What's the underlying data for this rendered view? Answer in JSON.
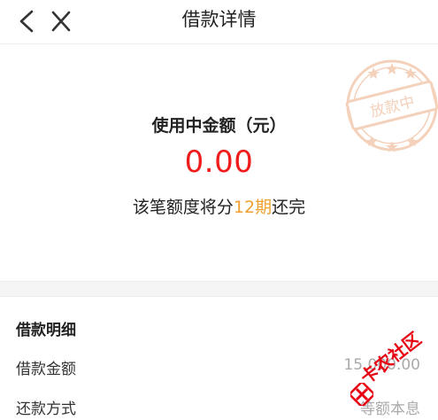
{
  "header": {
    "title": "借款详情"
  },
  "summary": {
    "amount_label": "使用中金额（元）",
    "amount_value": "0.00",
    "term_prefix": "该笔额度将分",
    "term_highlight": "12期",
    "term_suffix": "还完"
  },
  "stamp": {
    "text": "放款中"
  },
  "details": {
    "section_title": "借款明细",
    "rows": [
      {
        "label": "借款金额",
        "value": "15,000.00"
      },
      {
        "label": "还款方式",
        "value": "等额本息"
      }
    ]
  },
  "watermark": {
    "text": "卡农社区"
  },
  "colors": {
    "amount": "#f01c1c",
    "term_highlight": "#f0a030",
    "stamp": "#f2c9b0"
  }
}
